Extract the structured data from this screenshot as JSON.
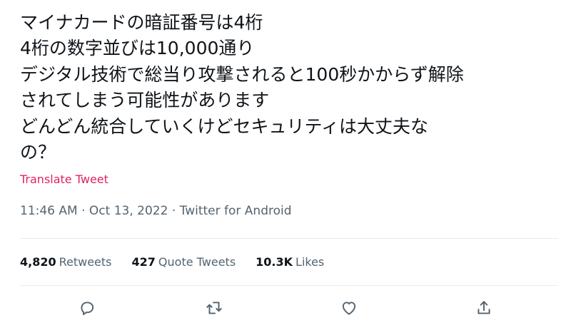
{
  "tweet": {
    "text_lines": [
      "マイナカードの暗証番号は4桁",
      "4桁の数字並びは10,000通り",
      "デジタル技術で総当り攻撃されると100秒かからず解除",
      "されてしまう可能性があります",
      "どんどん統合していくけどセキュリティは大丈夫な",
      "の？"
    ],
    "translate_label": "Translate Tweet",
    "time": "11:46 AM",
    "date": "Oct 13, 2022",
    "separator": "·",
    "source": "Twitter for Android"
  },
  "stats": {
    "retweets_count": "4,820",
    "retweets_label": "Retweets",
    "quote_count": "427",
    "quote_label": "Quote Tweets",
    "likes_count": "10.3K",
    "likes_label": "Likes"
  },
  "actions": {
    "reply_icon": "reply-icon",
    "retweet_icon": "retweet-icon",
    "like_icon": "heart-icon",
    "share_icon": "share-icon"
  },
  "colors": {
    "text": "#0f1419",
    "secondary": "#536471",
    "translate": "#e0245e",
    "divider": "#e6ecf0"
  }
}
